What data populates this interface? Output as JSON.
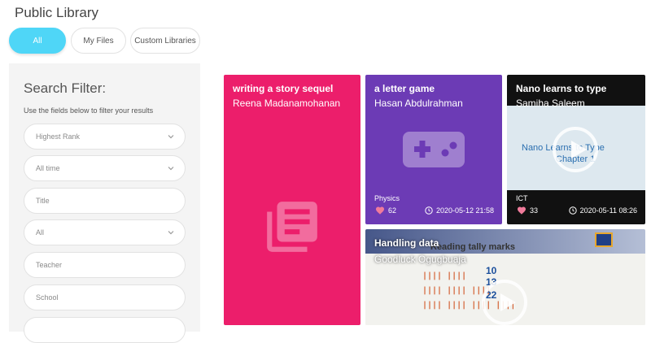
{
  "page": {
    "title": "Public Library"
  },
  "tabs": [
    {
      "label": "All",
      "active": true
    },
    {
      "label": "My Files",
      "active": false
    },
    {
      "label": "Custom Libraries",
      "active": false
    }
  ],
  "filter": {
    "title": "Search Filter:",
    "hint": "Use the fields below to filter your results",
    "fields": [
      {
        "value": "Highest Rank",
        "type": "select"
      },
      {
        "value": "All time",
        "type": "select"
      },
      {
        "placeholder": "Title",
        "type": "input"
      },
      {
        "value": "All",
        "type": "select"
      },
      {
        "placeholder": "Teacher",
        "type": "input"
      },
      {
        "placeholder": "School",
        "type": "input"
      }
    ]
  },
  "cards": [
    {
      "title": "writing a story sequel",
      "author": "Reena Madanamohanan",
      "color": "#ec1e6b",
      "icon": "library-books-icon"
    },
    {
      "title": "a letter game",
      "author": "Hasan Abdulrahman",
      "color": "#6c3bb5",
      "icon": "gamepad-icon",
      "subject": "Physics",
      "likes": "62",
      "date": "2020-05-12 21:58"
    },
    {
      "title": "Nano learns to type",
      "author": "Samiha Saleem",
      "color": "#111111",
      "icon": "play-icon",
      "subject": "ICT",
      "likes": "33",
      "date": "2020-05-11 08:26",
      "thumb_text_1": "Nano Learns to Type",
      "thumb_text_2": "Chapter 1"
    },
    {
      "title": "Handling data",
      "author": "Goodluck Ogugbuaja",
      "icon": "play-icon",
      "thumb_heading": "Reading tally marks",
      "thumb_numbers": [
        "10",
        "13",
        "22"
      ]
    }
  ],
  "colors": {
    "accent": "#4fd6f7",
    "heart": "#f07b9b"
  }
}
